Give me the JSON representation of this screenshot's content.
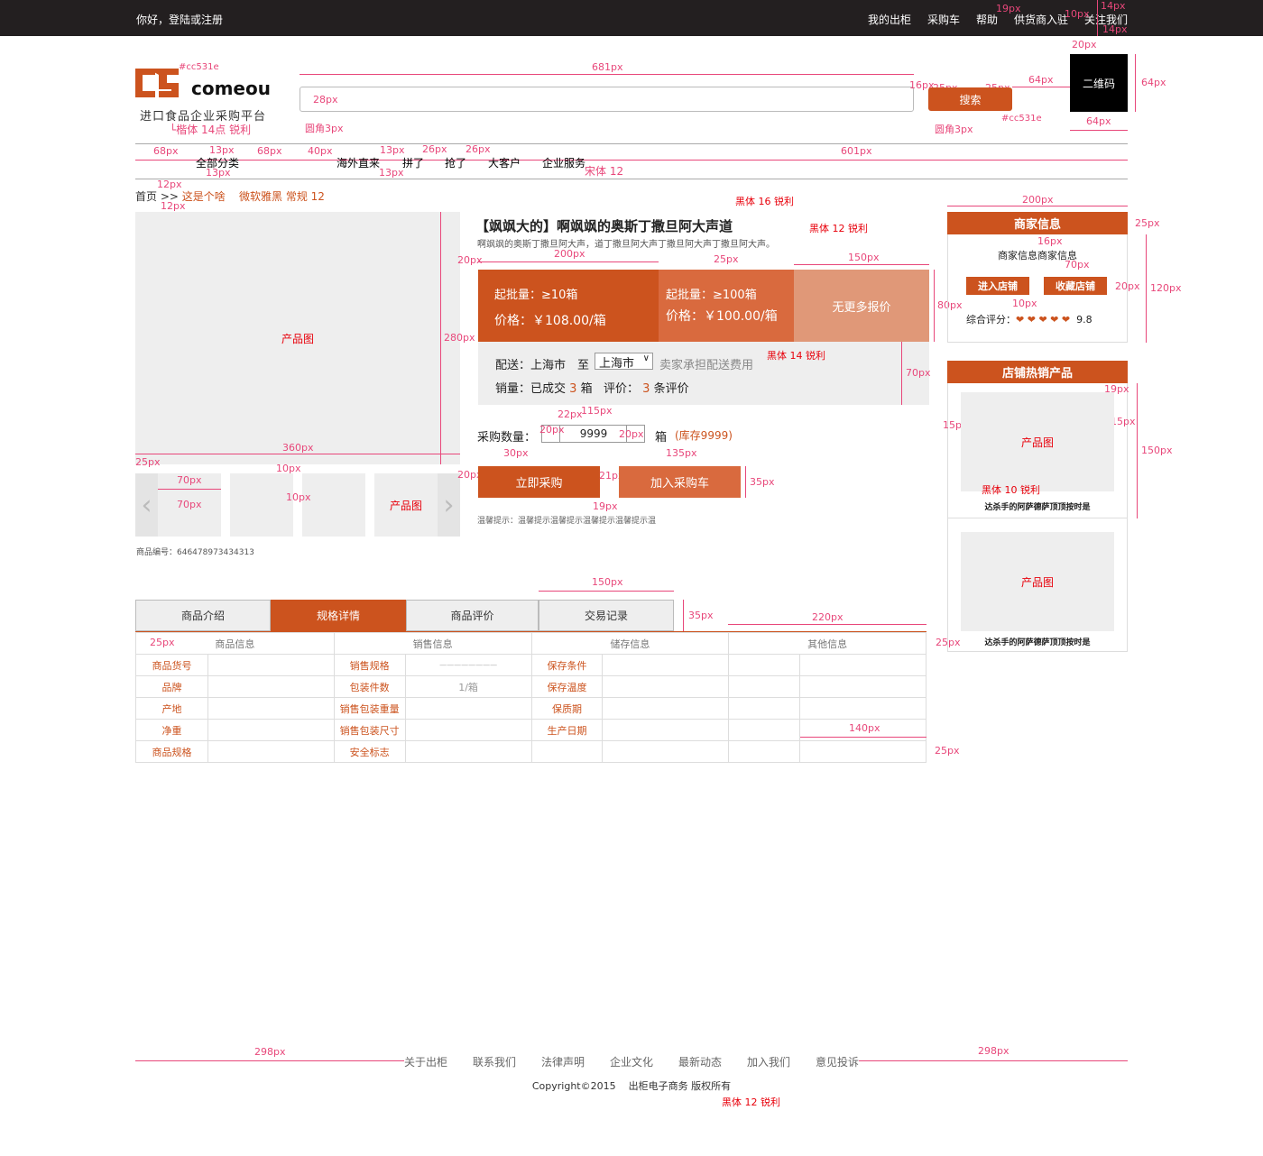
{
  "topbar": {
    "greeting": "你好，登陆或注册",
    "links": [
      "我的出柜",
      "采购车",
      "帮助",
      "供货商入驻",
      "关注我们"
    ]
  },
  "logo": {
    "brand": "comeout",
    "slogan": "进口食品企业采购平台",
    "color_note": "#cc531e",
    "font_note": "└楷体 14点 锐利"
  },
  "search": {
    "placeholder": "28px",
    "button": "搜索",
    "qrcode": "二维码",
    "radius_note": "圆角3px",
    "radius_note2": "圆角3px",
    "btn_color_note": "#cc531e"
  },
  "nav": {
    "items": [
      "全部分类",
      "海外直来",
      "拼了",
      "抢了",
      "大客户",
      "企业服务"
    ],
    "font_note": "宋体 12"
  },
  "breadcrumb": {
    "home": "首页",
    "sep": ">>",
    "item": "这是个啥",
    "font_note": "微软雅黑 常规 12"
  },
  "product": {
    "title": "【飒飒大的】啊飒飒的奥斯丁撒旦阿大声道",
    "subtitle": "啊飒飒的奥斯丁撒旦阿大声，道丁撒旦阿大声丁撒旦阿大声丁撒旦阿大声。",
    "title_font_note": "黑体 16 锐利",
    "sub_font_note": "黑体 12 锐利",
    "image_label": "产品图",
    "thumb_label": "产品图",
    "code": "商品编号：646478973434313"
  },
  "price": {
    "tier1_qty": "起批量：≥10箱",
    "tier1_price": "价格：￥108.00/箱",
    "tier2_qty": "起批量：≥100箱",
    "tier2_price": "价格：￥100.00/箱",
    "tier3": "无更多报价"
  },
  "delivery": {
    "label": "配送：上海市",
    "to": "至",
    "city": "上海市",
    "fee": "卖家承担配送费用",
    "sales": "销量：已成交",
    "sales_num": "3",
    "sales_unit": "箱",
    "reviews": "评价：",
    "reviews_num": "3",
    "reviews_unit": "条评价",
    "font_note": "黑体 14 锐利"
  },
  "purchase": {
    "label": "采购数量：",
    "qty": "9999",
    "unit": "箱",
    "stock": "(库存9999)",
    "buy": "立即采购",
    "cart": "加入采购车",
    "tip": "温馨提示：温馨提示温馨提示温馨提示温馨提示温"
  },
  "merchant": {
    "title": "商家信息",
    "info": "商家信息商家信息",
    "enter": "进入店铺",
    "fav": "收藏店铺",
    "rating_label": "综合评分：",
    "rating": "9.8",
    "hearts": 5
  },
  "hot": {
    "title": "店铺热销产品",
    "items": [
      {
        "img": "产品图",
        "name": "达杀手的阿萨德萨顶顶按时是",
        "font_note": "黑体 10 锐利"
      },
      {
        "img": "产品图",
        "name": "达杀手的阿萨德萨顶顶按时是"
      }
    ]
  },
  "tabs": [
    "商品介绍",
    "规格详情",
    "商品评价",
    "交易记录"
  ],
  "spec": {
    "headers": [
      "商品信息",
      "销售信息",
      "储存信息",
      "其他信息"
    ],
    "rows": [
      [
        "商品货号",
        "",
        "销售规格",
        "————————",
        "保存条件",
        "",
        "",
        ""
      ],
      [
        "品牌",
        "",
        "包装件数",
        "1/箱",
        "保存温度",
        "",
        "",
        ""
      ],
      [
        "产地",
        "",
        "销售包装重量",
        "",
        "保质期",
        "",
        "",
        ""
      ],
      [
        "净重",
        "",
        "销售包装尺寸",
        "",
        "生产日期",
        "",
        "",
        ""
      ],
      [
        "商品规格",
        "",
        "安全标志",
        "",
        "",
        "",
        "",
        ""
      ]
    ]
  },
  "footer": {
    "links": [
      "关于出柜",
      "联系我们",
      "法律声明",
      "企业文化",
      "最新动态",
      "加入我们",
      "意见投诉"
    ],
    "copyright": "Copyright©2015    出柜电子商务 版权所有",
    "font_note": "黑体 12 锐利"
  },
  "annotations": {
    "a14": "14px",
    "a19": "19px",
    "a10": "10px",
    "a14b": "14px",
    "a20": "20px",
    "a681": "681px",
    "a16": "16px",
    "a25": "25px",
    "a25b": "25px",
    "a64": "64px",
    "a64v": "64px",
    "a64b": "64px",
    "a68": "68px",
    "a13": "13px",
    "a68b": "68px",
    "a40": "40px",
    "a13b": "13px",
    "a26": "26px",
    "a26b": "26px",
    "a601": "601px",
    "a13c": "13px",
    "a13d": "13px",
    "a12": "12px",
    "a12b": "12px",
    "a280": "280px",
    "a360": "360px",
    "a25c": "25px",
    "a10b": "10px",
    "a70": "70px",
    "a70b": "70px",
    "a10c": "10px",
    "a20b": "20px",
    "a200": "200px",
    "a25d": "25px",
    "a150": "150px",
    "a80": "80px",
    "a70c": "70px",
    "a22": "22px",
    "a115": "115px",
    "a20c": "20px",
    "a20d": "20px",
    "a30": "30px",
    "a135": "135px",
    "a20e": "20px",
    "a21": "21px",
    "a35": "35px",
    "a19b": "19px",
    "a200b": "200px",
    "a25e": "25px",
    "a16b": "16px",
    "a70d": "70px",
    "a120": "120px",
    "a20f": "20px",
    "a10d": "10px",
    "a19c": "19px",
    "a15": "15px",
    "a15b": "15px",
    "a150b": "150px",
    "a150c": "150px",
    "a35b": "35px",
    "a220": "220px",
    "a25f": "25px",
    "a25g": "25px",
    "a140": "140px",
    "a25h": "25px",
    "a298": "298px",
    "a298b": "298px"
  }
}
